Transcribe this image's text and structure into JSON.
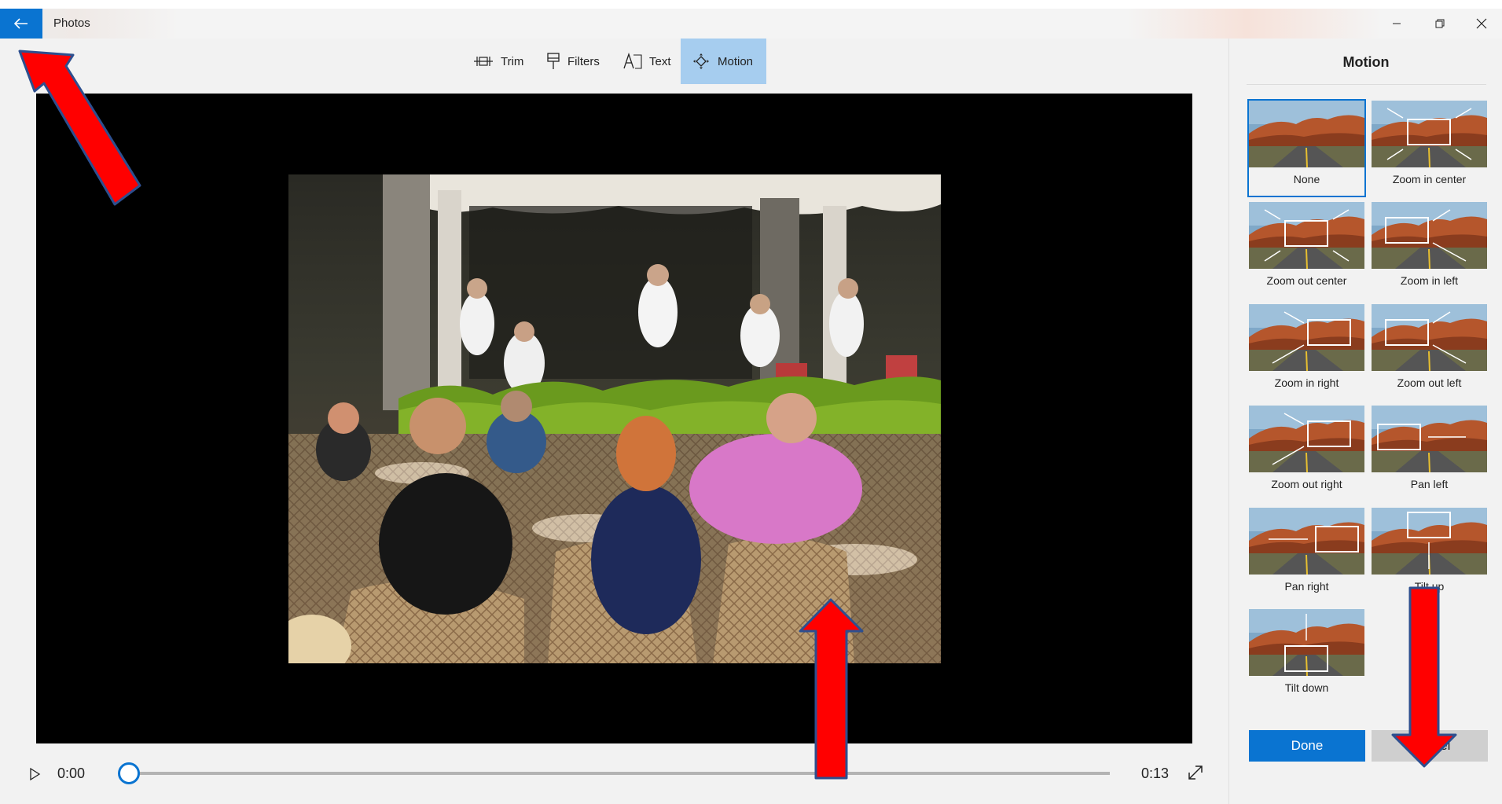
{
  "window": {
    "app_title": "Photos",
    "minimize_icon": "minimize-icon",
    "maximize_icon": "restore-icon",
    "close_icon": "close-icon"
  },
  "toolbar": {
    "tools": [
      {
        "label": "Trim",
        "icon": "trim-icon"
      },
      {
        "label": "Filters",
        "icon": "filters-icon"
      },
      {
        "label": "Text",
        "icon": "text-icon"
      },
      {
        "label": "Motion",
        "icon": "motion-icon",
        "active": true
      }
    ]
  },
  "player": {
    "time_current": "0:00",
    "time_total": "0:13",
    "progress": 0.0
  },
  "motion_panel": {
    "title": "Motion",
    "options": [
      {
        "label": "None",
        "selected": true
      },
      {
        "label": "Zoom in center"
      },
      {
        "label": "Zoom out center"
      },
      {
        "label": "Zoom in left"
      },
      {
        "label": "Zoom in right"
      },
      {
        "label": "Zoom out left"
      },
      {
        "label": "Zoom out right"
      },
      {
        "label": "Pan left"
      },
      {
        "label": "Pan right"
      },
      {
        "label": "Tilt up"
      },
      {
        "label": "Tilt down"
      }
    ],
    "done_label": "Done",
    "cancel_label": "Cancel"
  },
  "colors": {
    "accent": "#0a74d1",
    "active_tool": "#a6cdef",
    "annotation_arrow": "#ff0000"
  }
}
